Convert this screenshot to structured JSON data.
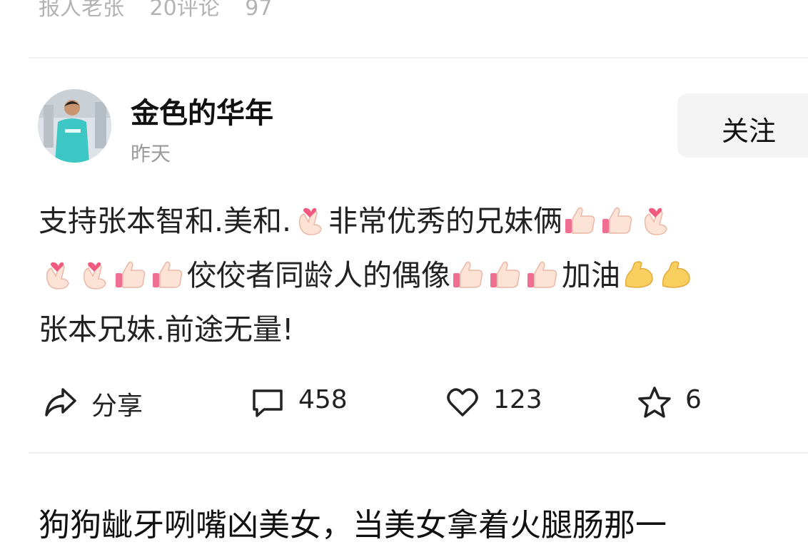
{
  "previous_post": {
    "author": "报人老张",
    "comments": "20评论",
    "extra": "97"
  },
  "post": {
    "author": {
      "name": "金色的华年",
      "time": "昨天"
    },
    "follow_label": "关注",
    "content": {
      "line1": [
        "支持张本智和.美和.",
        "非常优秀的兄妹俩"
      ],
      "line2": [
        "佼佼者同龄人的偶像",
        "加油"
      ],
      "line3": "张本兄妹.前途无量!"
    },
    "actions": {
      "share": "分享",
      "comments": "458",
      "likes": "123",
      "favorites": "6"
    }
  },
  "next_post": {
    "title": "狗狗龇牙咧嘴凶美女，当美女拿着火腿肠那一"
  },
  "icons": [
    "share-icon",
    "comment-icon",
    "heart-icon",
    "star-icon",
    "finger-heart-emoji",
    "thumbs-up-emoji",
    "flexed-biceps-emoji"
  ],
  "colors": {
    "text": "#222222",
    "meta": "#9a9a9a",
    "button_bg": "#f4f4f4",
    "divider": "#f0f0f0"
  }
}
